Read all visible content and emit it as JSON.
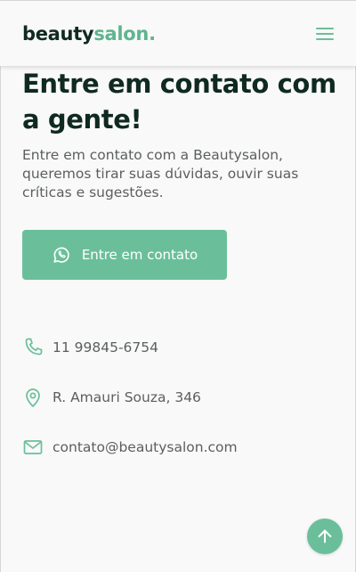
{
  "header": {
    "logo_part1": "beauty",
    "logo_part2": "salon.",
    "menu_icon": "hamburger-menu-icon"
  },
  "hero": {
    "title": "Entre em contato com a gente!",
    "description": "Entre em contato com a Beautysalon, queremos tirar suas dúvidas, ouvir suas críticas e sugestões.",
    "cta_label": "Entre em contato",
    "cta_icon": "whatsapp-icon"
  },
  "contacts": [
    {
      "icon": "phone-icon",
      "text": "11 99845-6754"
    },
    {
      "icon": "location-pin-icon",
      "text": "R. Amauri Souza, 346"
    },
    {
      "icon": "mail-icon",
      "text": "contato@beautysalon.com"
    }
  ],
  "scroll_top_icon": "arrow-up-icon",
  "colors": {
    "accent": "#6abf9a",
    "dark": "#0f2a20",
    "text": "#5b5e60",
    "background": "#f9f9f9"
  }
}
